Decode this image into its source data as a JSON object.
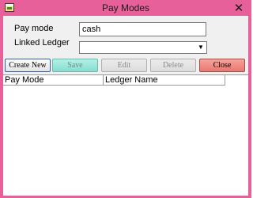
{
  "window": {
    "title": "Pay Modes",
    "close_glyph": "✕",
    "icon": "app-icon"
  },
  "form": {
    "pay_mode_label": "Pay mode",
    "pay_mode_value": "cash",
    "linked_ledger_label": "Linked Ledger",
    "linked_ledger_value": "",
    "dropdown_arrow": "▼"
  },
  "toolbar": {
    "create_label": "Create New",
    "save_label": "Save",
    "edit_label": "Edit",
    "delete_label": "Delete",
    "close_label": "Close"
  },
  "grid": {
    "columns": [
      "Pay Mode",
      "Ledger Name"
    ],
    "rows": []
  },
  "colors": {
    "titlebar": "#e8609a",
    "save_button": "#9fe6db",
    "close_button": "#ef8c84"
  }
}
